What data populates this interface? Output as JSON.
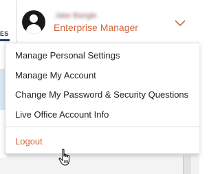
{
  "background": {
    "tab_fragment": "ES"
  },
  "user": {
    "name": "Jake Bangle",
    "role": "Enterprise Manager",
    "avatar_icon": "user-avatar-icon",
    "expand_icon": "chevron-down-icon"
  },
  "menu": {
    "items": [
      {
        "label": "Manage Personal Settings"
      },
      {
        "label": "Manage My Account"
      },
      {
        "label": "Change My Password & Security Questions"
      },
      {
        "label": "Live Office Account Info"
      }
    ],
    "logout_label": "Logout"
  },
  "colors": {
    "accent_orange": "#d4643a",
    "nav_blue": "#1d3d63",
    "text": "#222222"
  },
  "cursor": "hand-pointer-icon"
}
